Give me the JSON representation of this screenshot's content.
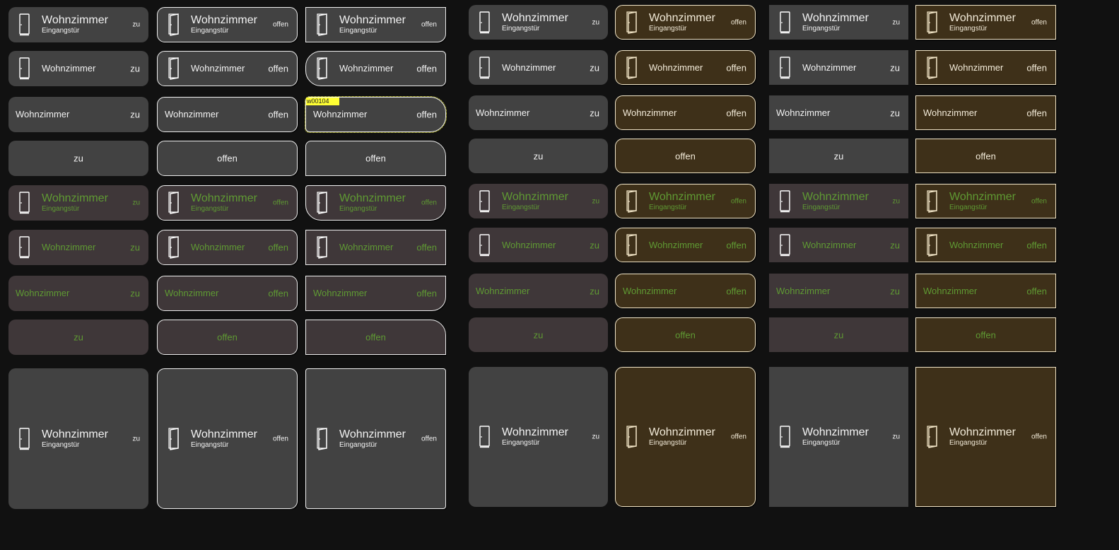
{
  "label": "Wohnzimmer",
  "sublabel": "Eingangstür",
  "selected_widget_id": "w00104",
  "columns": [
    {
      "state": "zu",
      "icon": "door-closed-icon",
      "style": "rounded"
    },
    {
      "state": "offen",
      "icon": "door-open-icon",
      "style": "rounded-bordered"
    },
    {
      "state": "offen",
      "icon": "door-open-icon",
      "style": "mixed-corners-bordered"
    },
    {
      "state": "zu",
      "icon": "door-closed-icon",
      "style": "rounded"
    },
    {
      "state": "offen",
      "icon": "door-open-icon",
      "style": "rounded-bordered-brown"
    },
    {
      "state": "zu",
      "icon": "door-closed-icon",
      "style": "square"
    },
    {
      "state": "offen",
      "icon": "door-open-icon",
      "style": "square-bordered-brown"
    }
  ],
  "colors": {
    "background": "#111111",
    "tile": "#424242",
    "tile_dim": "#3f3739",
    "tile_open": "#3e3019",
    "text_green": "#5f9a33",
    "highlight": "#ffff33"
  }
}
